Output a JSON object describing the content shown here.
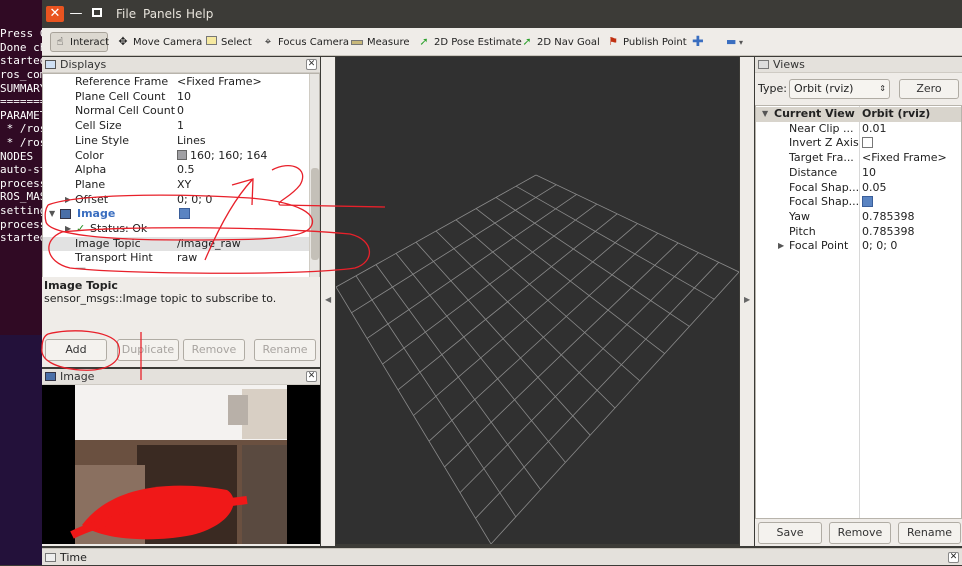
{
  "terminal": {
    "lines": [
      "Press C",
      "Done ch",
      "",
      "started",
      "ros_com",
      "",
      "SUMMARY",
      "=======",
      "",
      "PARAMET",
      " * /ros",
      " * /ros",
      "",
      "NODES",
      "",
      "auto-st",
      "process",
      "ROS_MAS",
      "",
      "setting",
      "process",
      "started"
    ]
  },
  "window": {
    "menu": [
      "File",
      "Panels",
      "Help"
    ]
  },
  "toolbar": {
    "tools": [
      {
        "label": "Interact",
        "icon": "interact-icon"
      },
      {
        "label": "Move Camera",
        "icon": "move-camera-icon"
      },
      {
        "label": "Select",
        "icon": "select-icon"
      },
      {
        "label": "Focus Camera",
        "icon": "focus-camera-icon"
      },
      {
        "label": "Measure",
        "icon": "measure-icon"
      },
      {
        "label": "2D Pose Estimate",
        "icon": "pose-estimate-icon"
      },
      {
        "label": "2D Nav Goal",
        "icon": "nav-goal-icon"
      },
      {
        "label": "Publish Point",
        "icon": "publish-point-icon"
      }
    ]
  },
  "displays": {
    "title": "Displays",
    "rows": [
      {
        "key": "Reference Frame",
        "value": "<Fixed Frame>"
      },
      {
        "key": "Plane Cell Count",
        "value": "10"
      },
      {
        "key": "Normal Cell Count",
        "value": "0"
      },
      {
        "key": "Cell Size",
        "value": "1"
      },
      {
        "key": "Line Style",
        "value": "Lines"
      },
      {
        "key": "Color",
        "value": "160; 160; 164"
      },
      {
        "key": "Alpha",
        "value": "0.5"
      },
      {
        "key": "Plane",
        "value": "XY"
      },
      {
        "key": "Offset",
        "value": "0; 0; 0"
      }
    ],
    "image_display": {
      "name": "Image",
      "checked": true
    },
    "status": "Status: Ok",
    "image_rows": [
      {
        "key": "Image Topic",
        "value": "/image_raw"
      },
      {
        "key": "Transport Hint",
        "value": "raw"
      }
    ],
    "help_title": "Image Topic",
    "help_text": "sensor_msgs::Image topic to subscribe to.",
    "buttons": {
      "add": "Add",
      "duplicate": "Duplicate",
      "remove": "Remove",
      "rename": "Rename"
    }
  },
  "image_panel": {
    "title": "Image"
  },
  "views": {
    "title": "Views",
    "type_label": "Type:",
    "type_value": "Orbit (rviz)",
    "zero": "Zero",
    "current_view": "Current View",
    "current_value": "Orbit (rviz)",
    "rows": [
      {
        "key": "Near Clip ...",
        "value": "0.01"
      },
      {
        "key": "Invert Z Axis",
        "value": ""
      },
      {
        "key": "Target Fra...",
        "value": "<Fixed Frame>"
      },
      {
        "key": "Distance",
        "value": "10"
      },
      {
        "key": "Focal Shap...",
        "value": "0.05"
      },
      {
        "key": "Focal Shap...",
        "value": ""
      },
      {
        "key": "Yaw",
        "value": "0.785398"
      },
      {
        "key": "Pitch",
        "value": "0.785398"
      },
      {
        "key": "Focal Point",
        "value": "0; 0; 0"
      }
    ],
    "buttons": {
      "save": "Save",
      "remove": "Remove",
      "rename": "Rename"
    }
  },
  "status_bar": {
    "title": "Time"
  },
  "colors": {
    "accent": "#e95420",
    "selection": "#5a84c2",
    "viewport": "#303030",
    "grid": "#8a8a8a",
    "annotation": "#e8202a"
  }
}
